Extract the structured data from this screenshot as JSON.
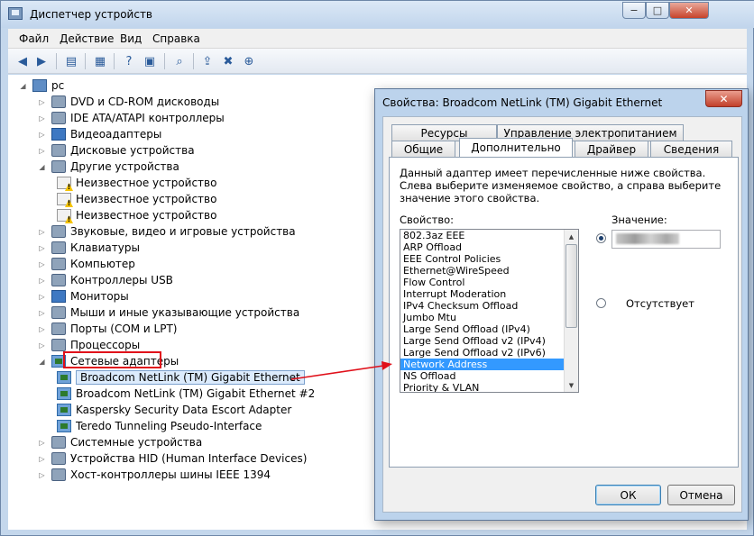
{
  "main_window": {
    "title": "Диспетчер устройств",
    "menu": [
      "Файл",
      "Действие",
      "Вид",
      "Справка"
    ],
    "caption_buttons": {
      "minimize": "−",
      "maximize": "□",
      "close": "✕"
    }
  },
  "tree": {
    "root": "pc",
    "items": [
      {
        "label": "DVD и CD-ROM дисководы",
        "expanded": false,
        "icon": "dvd-drive-icon"
      },
      {
        "label": "IDE ATA/ATAPI контроллеры",
        "expanded": false,
        "icon": "ide-controller-icon"
      },
      {
        "label": "Видеоадаптеры",
        "expanded": false,
        "icon": "display-adapter-icon"
      },
      {
        "label": "Дисковые устройства",
        "expanded": false,
        "icon": "disk-drive-icon"
      },
      {
        "label": "Другие устройства",
        "expanded": true,
        "icon": "other-devices-icon"
      },
      {
        "label": "Неизвестное устройство",
        "child": true,
        "icon": "unknown-device-warning-icon"
      },
      {
        "label": "Неизвестное устройство",
        "child": true,
        "icon": "unknown-device-warning-icon"
      },
      {
        "label": "Неизвестное устройство",
        "child": true,
        "icon": "unknown-device-warning-icon"
      },
      {
        "label": "Звуковые, видео и игровые устройства",
        "expanded": false,
        "icon": "sound-icon"
      },
      {
        "label": "Клавиатуры",
        "expanded": false,
        "icon": "keyboard-icon"
      },
      {
        "label": "Компьютер",
        "expanded": false,
        "icon": "computer-icon"
      },
      {
        "label": "Контроллеры USB",
        "expanded": false,
        "icon": "usb-icon"
      },
      {
        "label": "Мониторы",
        "expanded": false,
        "icon": "monitor-icon"
      },
      {
        "label": "Мыши и иные указывающие устройства",
        "expanded": false,
        "icon": "mouse-icon"
      },
      {
        "label": "Порты (COM и LPT)",
        "expanded": false,
        "icon": "port-icon"
      },
      {
        "label": "Процессоры",
        "expanded": false,
        "icon": "processor-icon"
      },
      {
        "label": "Сетевые адаптеры",
        "expanded": true,
        "icon": "network-adapter-icon"
      },
      {
        "label": "Broadcom NetLink (TM) Gigabit Ethernet",
        "child": true,
        "selected": true,
        "icon": "network-adapter-icon"
      },
      {
        "label": "Broadcom NetLink (TM) Gigabit Ethernet #2",
        "child": true,
        "icon": "network-adapter-icon"
      },
      {
        "label": "Kaspersky Security Data Escort Adapter",
        "child": true,
        "icon": "network-adapter-icon"
      },
      {
        "label": "Teredo Tunneling Pseudo-Interface",
        "child": true,
        "icon": "network-adapter-icon"
      },
      {
        "label": "Системные устройства",
        "expanded": false,
        "icon": "system-devices-icon"
      },
      {
        "label": "Устройства HID (Human Interface Devices)",
        "expanded": false,
        "icon": "hid-icon"
      },
      {
        "label": "Хост-контроллеры шины IEEE 1394",
        "expanded": false,
        "icon": "ieee1394-icon"
      }
    ]
  },
  "dialog": {
    "title": "Свойства: Broadcom NetLink (TM) Gigabit Ethernet",
    "close": "✕",
    "tabs_row1": [
      "Ресурсы",
      "Управление электропитанием"
    ],
    "tabs_row2": [
      "Общие",
      "Дополнительно",
      "Драйвер",
      "Сведения"
    ],
    "active_tab": "Дополнительно",
    "description": "Данный адаптер имеет перечисленные ниже свойства. Слева выберите изменяемое свойство, а справа выберите значение этого свойства.",
    "property_label": "Свойство:",
    "value_label": "Значение:",
    "properties": [
      "802.3az EEE",
      "ARP Offload",
      "EEE Control Policies",
      "Ethernet@WireSpeed",
      "Flow Control",
      "Interrupt Moderation",
      "IPv4 Checksum Offload",
      "Jumbo Mtu",
      "Large Send Offload (IPv4)",
      "Large Send Offload v2 (IPv4)",
      "Large Send Offload v2 (IPv6)",
      "Network Address",
      "NS Offload",
      "Priority & VLAN"
    ],
    "selected_property": "Network Address",
    "absent_label": "Отсутствует",
    "ok": "ОК",
    "cancel": "Отмена"
  },
  "annotation_color": "#e0101a"
}
